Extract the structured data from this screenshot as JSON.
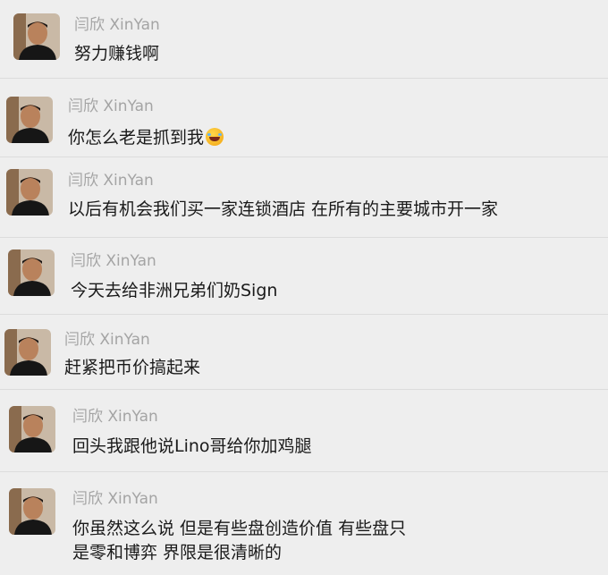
{
  "sender_name": "闫欣 XinYan",
  "messages": [
    {
      "sender": "闫欣 XinYan",
      "text": "努力赚钱啊",
      "emoji": ""
    },
    {
      "sender": "闫欣 XinYan",
      "text": "你怎么老是抓到我",
      "emoji": "rolling-on-floor-laughing-emoji"
    },
    {
      "sender": "闫欣 XinYan",
      "text": "以后有机会我们买一家连锁酒店 在所有的主要城市开一家",
      "emoji": ""
    },
    {
      "sender": "闫欣 XinYan",
      "text": "今天去给非洲兄弟们奶Sign",
      "emoji": ""
    },
    {
      "sender": "闫欣 XinYan",
      "text": "赶紧把币价搞起来",
      "emoji": ""
    },
    {
      "sender": "闫欣 XinYan",
      "text": "回头我跟他说Lino哥给你加鸡腿",
      "emoji": ""
    },
    {
      "sender": "闫欣 XinYan",
      "text_line1": "你虽然这么说 但是有些盘创造价值 有些盘只",
      "text_line2": "是零和博弈 界限是很清晰的",
      "emoji": ""
    }
  ]
}
